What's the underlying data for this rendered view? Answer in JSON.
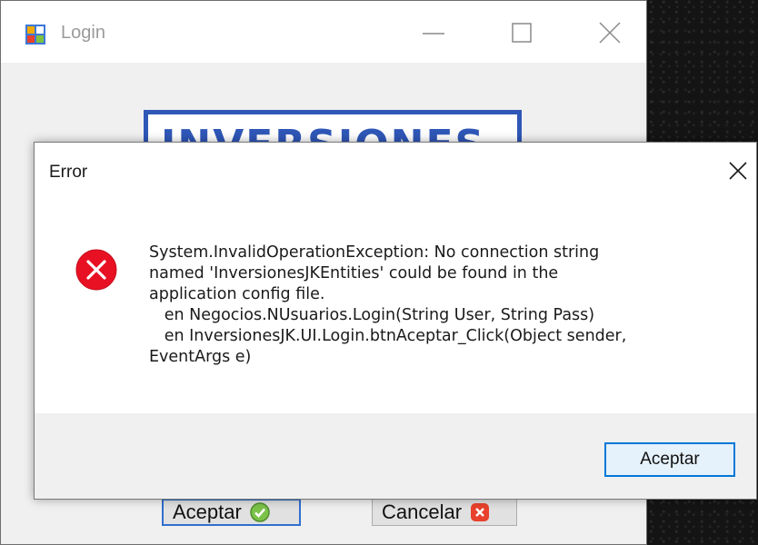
{
  "login_window": {
    "title": "Login",
    "logo_text": "INVERSIONES",
    "accept_label": "Aceptar",
    "cancel_label": "Cancelar"
  },
  "error_dialog": {
    "title": "Error",
    "message": "System.InvalidOperationException: No connection string\nnamed 'InversionesJKEntities' could be found in the\napplication config file.\n   en Negocios.NUsuarios.Login(String User, String Pass)\n   en InversionesJK.UI.Login.btnAceptar_Click(Object sender,\nEventArgs e)",
    "accept_label": "Aceptar"
  },
  "icons": {
    "error": "error-x-circle-icon",
    "close": "close-icon",
    "minimize": "minimize-icon",
    "maximize": "maximize-icon",
    "check": "check-circle-icon",
    "cancel": "cancel-x-icon"
  },
  "colors": {
    "accent": "#0078d7",
    "error_red": "#e81123",
    "logo_blue": "#2f57b7"
  }
}
